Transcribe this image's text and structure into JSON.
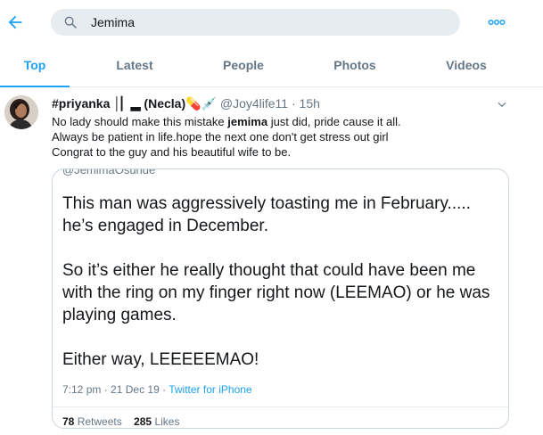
{
  "search": {
    "value": "Jemima"
  },
  "icons": {
    "back": "arrow-left-icon",
    "search": "search-icon",
    "more": "more-dots-icon",
    "caret": "chevron-down-icon"
  },
  "colors": {
    "accent": "#1da1f2",
    "muted": "#657786",
    "search_bg": "#e6ecf0"
  },
  "tabs": [
    {
      "label": "Top",
      "active": true
    },
    {
      "label": "Latest",
      "active": false
    },
    {
      "label": "People",
      "active": false
    },
    {
      "label": "Photos",
      "active": false
    },
    {
      "label": "Videos",
      "active": false
    }
  ],
  "tweet": {
    "name": "#priyanka │▏▂ (Necla)💊💉",
    "handle": "@Joy4life11",
    "separator": "·",
    "time": "15h",
    "line1_before": "No lady should make this mistake ",
    "line1_bold": "jemima",
    "line1_after": " just did, pride cause it all.",
    "line2": "Always be patient in life.hope the next one don't get stress out girl",
    "line3": "Congrat to the guy and his beautiful wife to be.",
    "quote": {
      "handle": "@JemimaOsunde",
      "p1": "This man was aggressively toasting me in February..... he’s engaged in December.",
      "p2": "So it’s either he really thought that could have been me with the ring on my finger right now (LEEMAO) or he was playing games.",
      "p3": "Either way, LEEEEEMAO!",
      "time": "7:12 pm",
      "sep": "·",
      "date": "21 Dec 19",
      "source": "Twitter for iPhone",
      "retweets_count": "78",
      "retweets_label": "Retweets",
      "likes_count": "285",
      "likes_label": "Likes"
    }
  }
}
